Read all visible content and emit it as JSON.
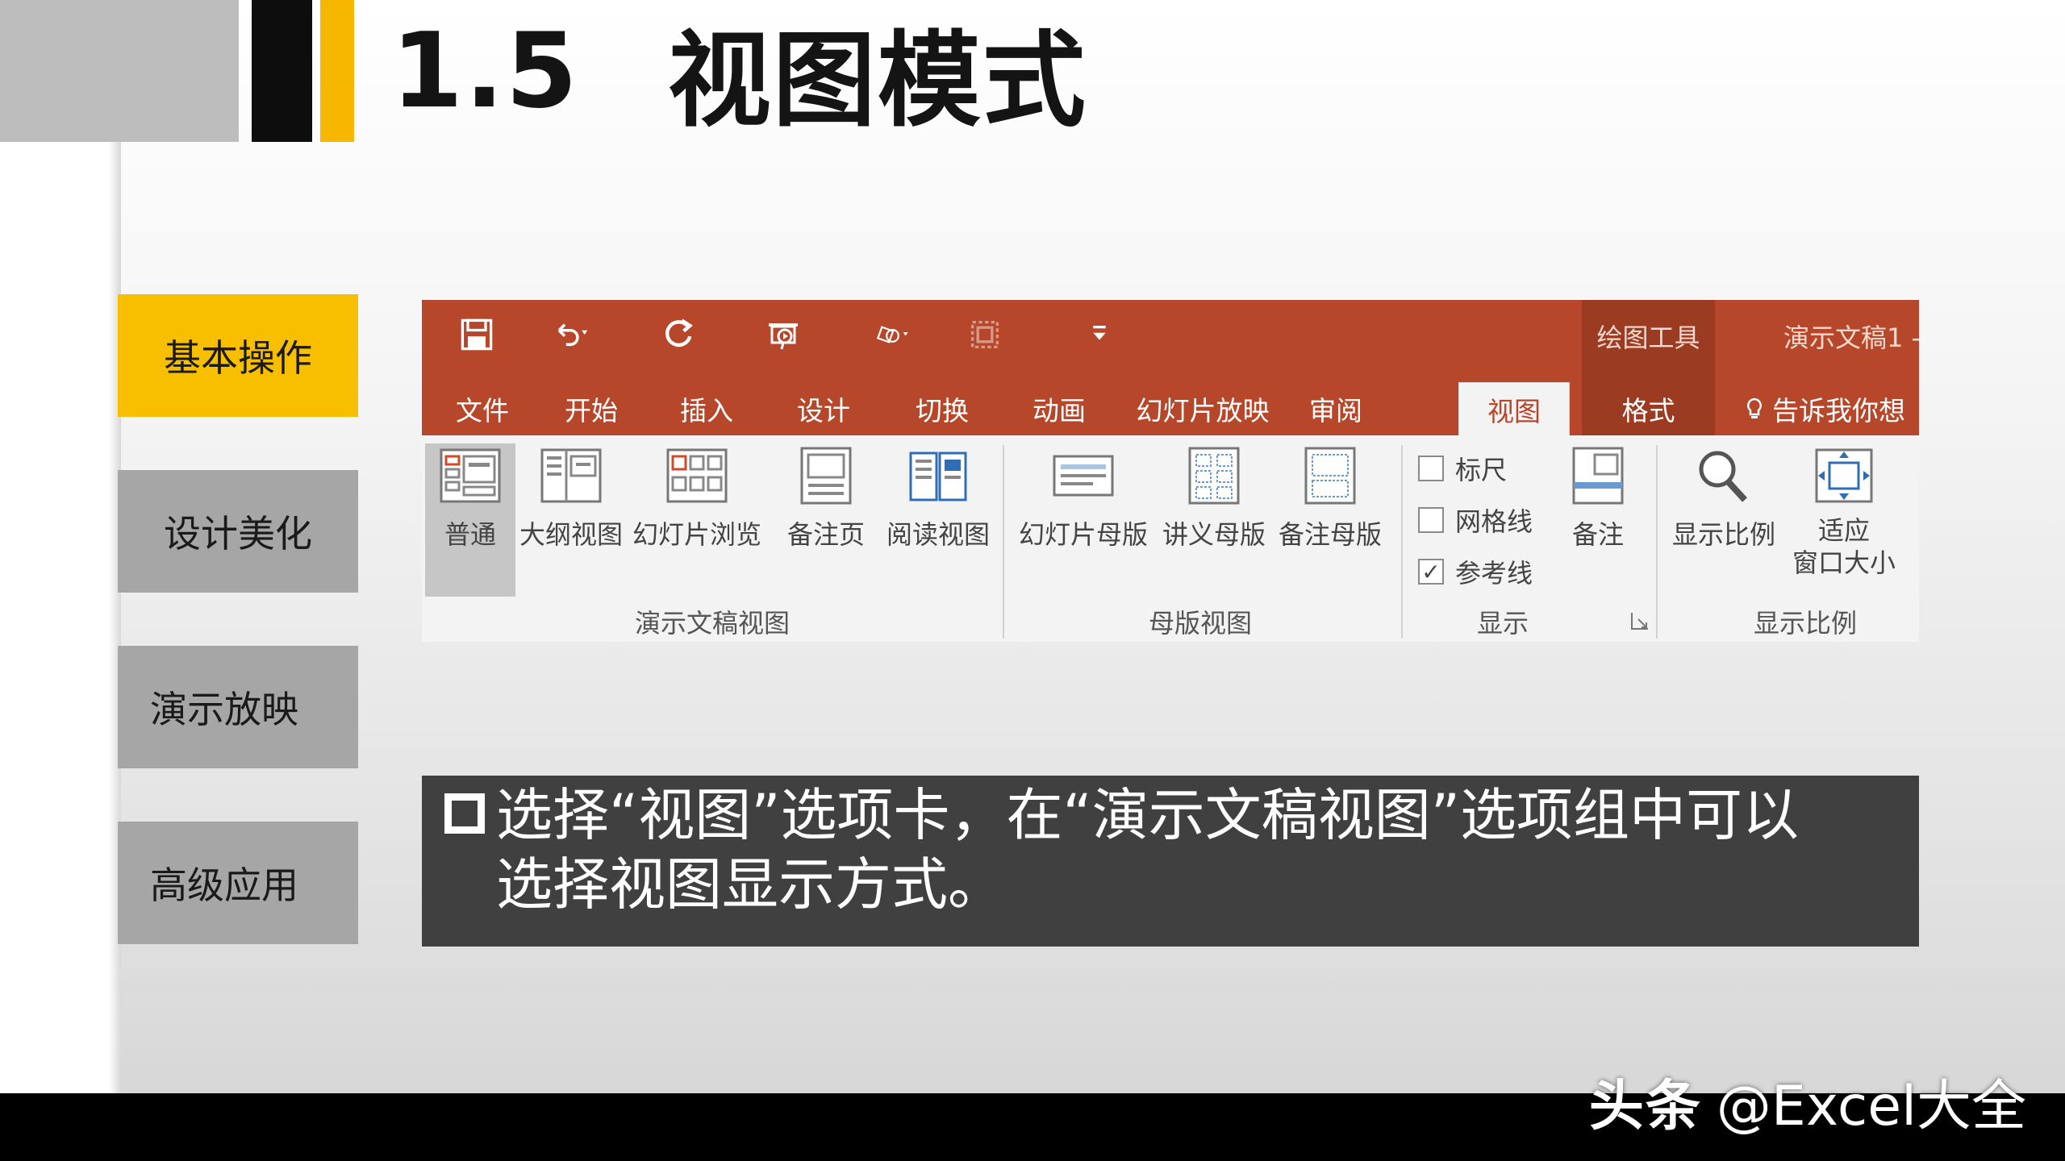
{
  "slide": {
    "section_number": "1.5",
    "title": "视图模式"
  },
  "nav": [
    {
      "label": "基本操作",
      "active": true
    },
    {
      "label": "设计美化",
      "active": false
    },
    {
      "label": "演示放映",
      "active": false
    },
    {
      "label": "高级应用",
      "active": false
    }
  ],
  "ribbon": {
    "context_tab_group": "绘图工具",
    "doc_title": "演示文稿1 -",
    "tabs": [
      "文件",
      "开始",
      "插入",
      "设计",
      "切换",
      "动画",
      "幻灯片放映",
      "审阅",
      "视图",
      "格式"
    ],
    "selected_tab": "视图",
    "tell_me": "告诉我你想",
    "groups": {
      "presentation_views": {
        "label": "演示文稿视图",
        "buttons": [
          "普通",
          "大纲视图",
          "幻灯片浏览",
          "备注页",
          "阅读视图"
        ]
      },
      "master_views": {
        "label": "母版视图",
        "buttons": [
          "幻灯片母版",
          "讲义母版",
          "备注母版"
        ]
      },
      "show": {
        "label": "显示",
        "checkboxes": [
          {
            "label": "标尺",
            "checked": false
          },
          {
            "label": "网格线",
            "checked": false
          },
          {
            "label": "参考线",
            "checked": true
          }
        ],
        "notes_button": "备注"
      },
      "zoom": {
        "label": "显示比例",
        "zoom_button": "显示比例",
        "fit_button_line1": "适应",
        "fit_button_line2": "窗口大小"
      }
    }
  },
  "info": {
    "text_line1": "选择“视图”选项卡，在“演示文稿视图”选项组中可以",
    "text_line2": "选择视图显示方式。"
  },
  "watermark": {
    "brand": "头条",
    "handle": "@Excel大全"
  },
  "colors": {
    "accent_yellow": "#f7bf00",
    "ribbon_red": "#b7472a",
    "nav_gray": "#a6a6a6",
    "info_bg": "#404040"
  }
}
